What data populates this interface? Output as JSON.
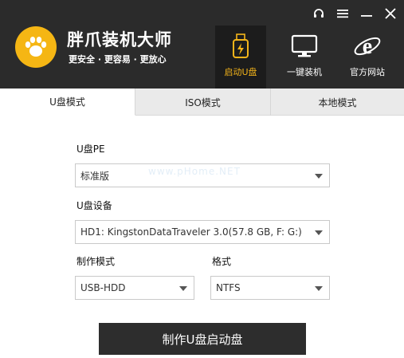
{
  "app": {
    "name": "胖爪装机大师",
    "slogan": "更安全 · 更容易 · 更放心"
  },
  "window_controls": [
    "headset-icon",
    "menu-icon",
    "minimize-icon",
    "close-icon"
  ],
  "nav": [
    {
      "label": "启动U盘",
      "icon": "usb-drive-icon",
      "active": true
    },
    {
      "label": "一键装机",
      "icon": "monitor-icon",
      "active": false
    },
    {
      "label": "官方网站",
      "icon": "ie-browser-icon",
      "active": false
    }
  ],
  "tabs": [
    {
      "label": "U盘模式",
      "active": true
    },
    {
      "label": "ISO模式",
      "active": false
    },
    {
      "label": "本地模式",
      "active": false
    }
  ],
  "form": {
    "pe_label": "U盘PE",
    "pe_value": "标准版",
    "device_label": "U盘设备",
    "device_value": "HD1: KingstonDataTraveler 3.0(57.8 GB, F: G:)",
    "mode_label": "制作模式",
    "mode_value": "USB-HDD",
    "format_label": "格式",
    "format_value": "NTFS"
  },
  "watermark": "www.pHome.NET",
  "make_button": "制作U盘启动盘",
  "colors": {
    "header_bg": "#2b2b2b",
    "accent": "#f4b41a",
    "logo": "#f5b614",
    "button_bg": "#2d2d2d"
  }
}
